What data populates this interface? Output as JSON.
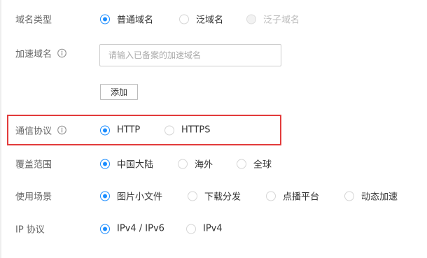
{
  "form": {
    "domain_type": {
      "label": "域名类型",
      "options": [
        "普通域名",
        "泛域名",
        "泛子域名"
      ],
      "selected": "普通域名",
      "disabled": [
        "泛子域名"
      ]
    },
    "accel_domain": {
      "label": "加速域名",
      "placeholder": "请输入已备案的加速域名",
      "value": "",
      "add_button": "添加"
    },
    "protocol": {
      "label": "通信协议",
      "options": [
        "HTTP",
        "HTTPS"
      ],
      "selected": "HTTP"
    },
    "coverage": {
      "label": "覆盖范围",
      "options": [
        "中国大陆",
        "海外",
        "全球"
      ],
      "selected": "中国大陆"
    },
    "scenario": {
      "label": "使用场景",
      "options": [
        "图片小文件",
        "下载分发",
        "点播平台",
        "动态加速"
      ],
      "selected": "图片小文件"
    },
    "ip_protocol": {
      "label": "IP 协议",
      "options": [
        "IPv4 / IPv6",
        "IPv4"
      ],
      "selected": "IPv4 / IPv6"
    }
  },
  "colors": {
    "accent": "#1a8cff",
    "highlight_border": "#e23b3b",
    "label_text": "#666666",
    "disabled_text": "#bbbbbb"
  },
  "icons": {
    "info": "info-circle-icon"
  }
}
